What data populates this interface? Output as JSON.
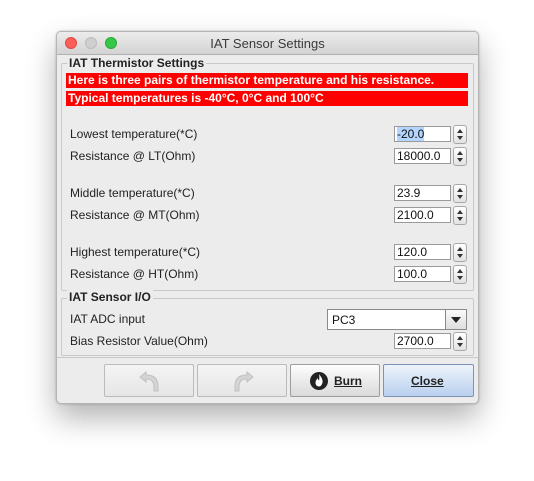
{
  "window": {
    "title": "IAT Sensor Settings"
  },
  "thermistor": {
    "group_title": "IAT Thermistor Settings",
    "warning_1": "Here is three pairs of thermistor temperature and his resistance.",
    "warning_2": "Typical temperatures is -40°C, 0°C and 100°C",
    "rows": [
      {
        "label": "Lowest temperature(*C)",
        "value": "-20.0"
      },
      {
        "label": "Resistance @ LT(Ohm)",
        "value": "18000.0"
      },
      {
        "label": "Middle temperature(*C)",
        "value": "23.9"
      },
      {
        "label": "Resistance @ MT(Ohm)",
        "value": "2100.0"
      },
      {
        "label": "Highest temperature(*C)",
        "value": "120.0"
      },
      {
        "label": "Resistance @ HT(Ohm)",
        "value": "100.0"
      }
    ]
  },
  "sensor_io": {
    "group_title": "IAT Sensor I/O",
    "adc_label": "IAT ADC input",
    "adc_value": "PC3",
    "bias_label": "Bias Resistor Value(Ohm)",
    "bias_value": "2700.0"
  },
  "buttons": {
    "undo_icon": "undo-arrow-icon",
    "redo_icon": "redo-arrow-icon",
    "burn_icon": "flame-icon",
    "burn_label": "Burn",
    "close_label": "Close"
  },
  "colors": {
    "warning_bg": "#ff0000",
    "warning_text": "#ffffff",
    "selection": "#b4d5fe",
    "close_button": "#b9d0ee"
  }
}
